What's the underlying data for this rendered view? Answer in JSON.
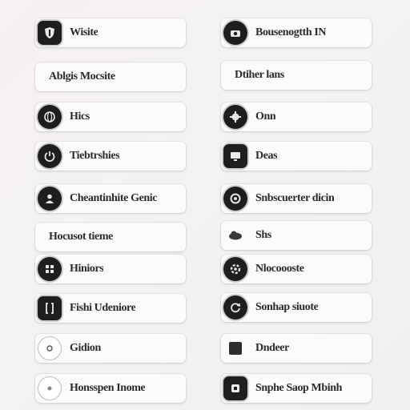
{
  "left_items": [
    {
      "label": "Wisite",
      "icon": "shield-icon"
    },
    {
      "label": "Ablgis Mocsite",
      "icon": "dot-icon"
    },
    {
      "label": "Hics",
      "icon": "globe-icon"
    },
    {
      "label": "Tiebtrshies",
      "icon": "power-icon"
    },
    {
      "label": "Cheantinhite Genic",
      "icon": "person-icon"
    },
    {
      "label": "Hocusot tieme",
      "icon": "toggle-icon"
    },
    {
      "label": "Hiniors",
      "icon": "grid-icon"
    },
    {
      "label": "Fishi Udeniore",
      "icon": "bracket-icon"
    },
    {
      "label": "Gidion",
      "icon": "ring-icon"
    },
    {
      "label": "Honsspen Inome",
      "icon": "circle-icon"
    }
  ],
  "right_items": [
    {
      "label": "Bousenogtth IN",
      "icon": "camera-icon"
    },
    {
      "label": "Dtiher lans",
      "icon": "target-icon"
    },
    {
      "label": "Onn",
      "icon": "gear-icon"
    },
    {
      "label": "Deas",
      "icon": "monitor-icon"
    },
    {
      "label": "Snbscuerter dicin",
      "icon": "aperture-icon"
    },
    {
      "label": "Shs",
      "icon": "cloud-icon"
    },
    {
      "label": "Nlocoooste",
      "icon": "settings-icon"
    },
    {
      "label": "Sonhap siuote",
      "icon": "reload-icon"
    },
    {
      "label": "Dndeer",
      "icon": "square-icon"
    },
    {
      "label": "Snphe Saop Mbinh",
      "icon": "tile-icon"
    }
  ]
}
